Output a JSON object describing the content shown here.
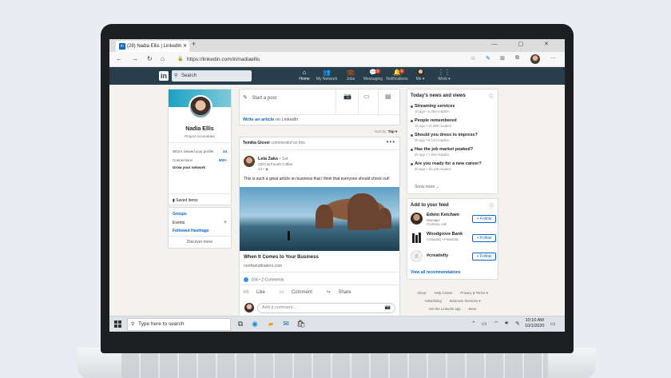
{
  "browser": {
    "tab_title": "(28) Nadia Ellis | LinkedIn",
    "tab_close": "✕",
    "new_tab": "+",
    "window_controls": "—  ▢  ✕",
    "url": "https://linkedin.com/in/nadiaellis",
    "icons": [
      "back-icon",
      "forward-icon",
      "refresh-icon",
      "home-icon",
      "lock-icon",
      "favorites-star-icon",
      "pen-icon",
      "collections-icon",
      "extensions-icon",
      "profile-avatar-icon",
      "more-icon"
    ]
  },
  "linkedin_nav": {
    "search_placeholder": "Search",
    "items": [
      {
        "label": "Home",
        "icon": "⌂"
      },
      {
        "label": "My Network",
        "icon": "👥"
      },
      {
        "label": "Jobs",
        "icon": "💼"
      },
      {
        "label": "Messaging",
        "icon": "💬",
        "badge": "1"
      },
      {
        "label": "Notifications",
        "icon": "🔔",
        "badge": "2"
      },
      {
        "label": "Me ▾",
        "icon": ""
      },
      {
        "label": "Work ▾",
        "icon": "⋮⋮"
      }
    ]
  },
  "profile": {
    "name": "Nadia Ellis",
    "role": "Project Accountant",
    "viewed_label": "Who's viewed your profile",
    "viewed_count": "24",
    "connections_label": "Connections",
    "connections_count": "500+",
    "grow_label": "Grow your network",
    "saved_items": "Saved items"
  },
  "groups": {
    "groups": "Groups",
    "events": "Events",
    "hashtags": "Followed Hashtags",
    "discover": "Discover more"
  },
  "share": {
    "start_post": "Start a post",
    "write_article_bold": "Write an article",
    "write_article_rest": "on LinkedIn",
    "sort_by": "Sort by:",
    "sort_value": "Top ▾"
  },
  "post": {
    "commenter": "Temika Glover",
    "comment_note": "commented on this",
    "author": "Lela Zaks",
    "author_degree": "• 1st",
    "author_title": "CEO at Fourth Coffee",
    "time": "4d • ◉",
    "text": "This is such a great article on business that I think that everyone should check out!",
    "link_title": "When It Comes to Your Business",
    "link_url": "northwindtraders.com",
    "stats": "104 • 2 Comments",
    "like": "Like",
    "comment": "Comment",
    "share": "Share",
    "add_comment": "Add a comment..."
  },
  "news": {
    "title": "Today's news and views",
    "items": [
      {
        "title": "Streaming services",
        "meta": "1h ago • 5,456 readers"
      },
      {
        "title": "People remembered",
        "meta": "1h ago • 12,389 readers"
      },
      {
        "title": "Should you dress to impress?",
        "meta": "2h ago • 9,143 readers"
      },
      {
        "title": "Has the job market peaked?",
        "meta": "2h ago • 7,653 readers"
      },
      {
        "title": "Are you ready for a new career?",
        "meta": "4h ago • 15,146 readers"
      }
    ],
    "show_more": "Show more ⌄"
  },
  "feed": {
    "title": "Add to your feed",
    "items": [
      {
        "name": "Edwin Ketcham",
        "sub1": "Manager",
        "sub2": "Contoso, Ltd.",
        "follow": "+ Follow"
      },
      {
        "name": "Woodgrove Bank",
        "sub1": "Company • Financial",
        "sub2": "",
        "follow": "+ Follow"
      },
      {
        "name": "#creativity",
        "sub1": "",
        "sub2": "",
        "follow": "+ Follow"
      }
    ],
    "view_all": "View all recommendations"
  },
  "footer": {
    "about": "About",
    "help": "Help Center",
    "privacy": "Privacy & Terms ▾",
    "advertising": "Advertising",
    "business": "Business Services ▾",
    "app": "Get the LinkedIn app",
    "more": "More"
  },
  "taskbar": {
    "search_placeholder": "Type here to search",
    "time": "10:10 AM",
    "date": "10/1/2020"
  },
  "colors": {
    "linkedin_blue": "#0a66c2",
    "nav_dark": "#283e4a"
  }
}
